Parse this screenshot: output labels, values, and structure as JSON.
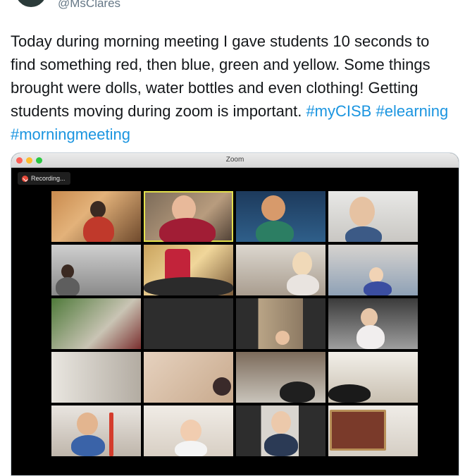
{
  "tweet": {
    "handle": "@MsClares",
    "text_plain": "Today during morning meeting I gave students 10 seconds to find something red, then blue, green and yellow. Some things brought were dolls, water bottles and even clothing! Getting students moving during zoom is important.",
    "hashtags": [
      "#myCISB",
      "#elearning",
      "#morningmeeting"
    ],
    "hashtag_color": "#1b95e0"
  },
  "zoom": {
    "window_title": "Zoom",
    "recording_label": "Recording...",
    "participant_count": 20,
    "active_speaker_index": 1,
    "active_speaker_color": "#e3e04c"
  }
}
